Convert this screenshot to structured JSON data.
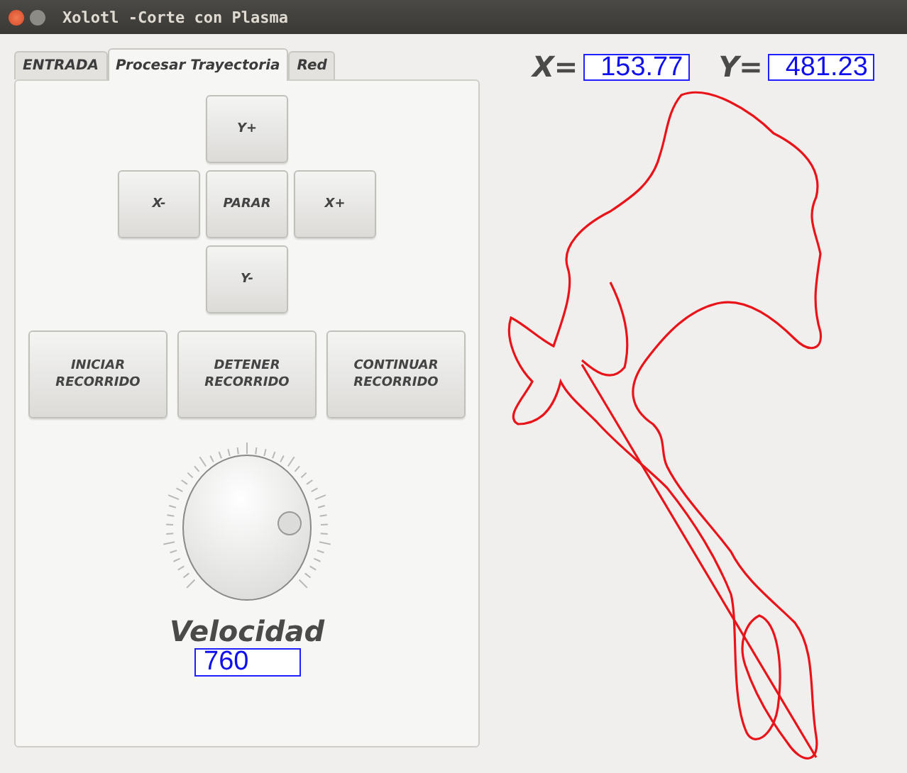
{
  "window": {
    "title": "Xolotl -Corte con Plasma"
  },
  "tabs": [
    {
      "label": "ENTRADA",
      "selected": false
    },
    {
      "label": "Procesar Trayectoria",
      "selected": true
    },
    {
      "label": "Red",
      "selected": false
    }
  ],
  "jog_buttons": [
    {
      "label": "Y+"
    },
    {
      "label": "X-"
    },
    {
      "label": "PARAR"
    },
    {
      "label": "X+"
    },
    {
      "label": "Y-"
    }
  ],
  "route_buttons": [
    {
      "label": "INICIAR RECORRIDO"
    },
    {
      "label": "DETENER RECORRIDO"
    },
    {
      "label": "CONTINUAR RECORRIDO"
    }
  ],
  "speed": {
    "label": "Velocidad",
    "value": "760"
  },
  "coordinates": [
    {
      "label": "X=",
      "value": "153.77"
    },
    {
      "label": "Y=",
      "value": "481.23"
    }
  ]
}
